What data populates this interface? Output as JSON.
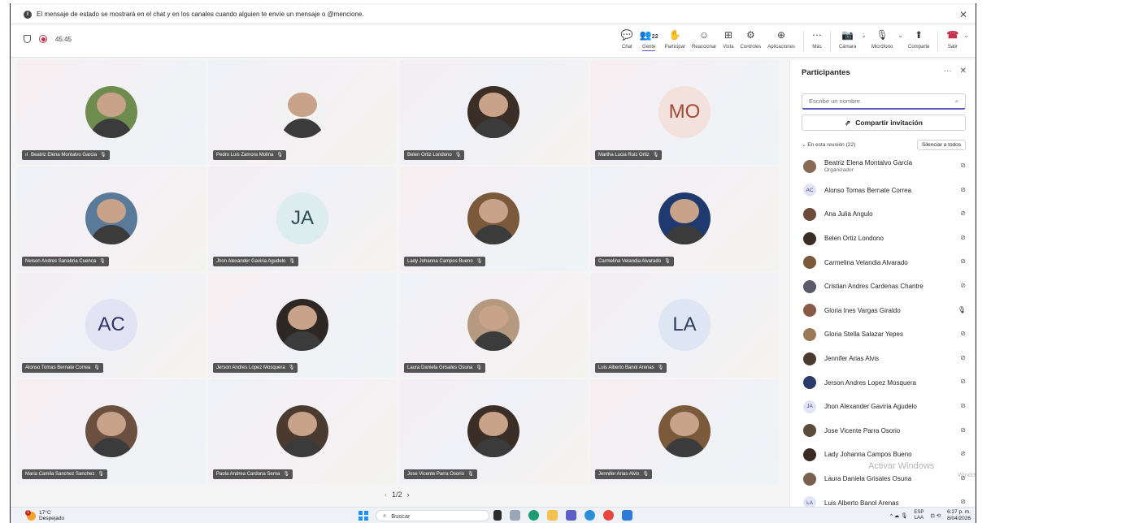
{
  "banner": {
    "text": "El mensaje de estado se mostrará en el chat y en los canales cuando alguien te envíe un mensaje o @mencione.",
    "info_glyph": "i",
    "close_glyph": "✕"
  },
  "toolbar": {
    "timer": "45:45",
    "people_count": "22",
    "buttons": [
      {
        "label": "Chat",
        "icon": "chat-icon",
        "glyph": "💬"
      },
      {
        "label": "Gente",
        "icon": "people-icon",
        "glyph": "👥"
      },
      {
        "label": "Participar",
        "icon": "raise-hand-icon",
        "glyph": "✋"
      },
      {
        "label": "Reaccionar",
        "icon": "react-icon",
        "glyph": "☺"
      },
      {
        "label": "Vista",
        "icon": "view-icon",
        "glyph": "⊞"
      },
      {
        "label": "Controles",
        "icon": "controls-icon",
        "glyph": "⚙"
      },
      {
        "label": "Aplicaciones",
        "icon": "apps-icon",
        "glyph": "⊕"
      },
      {
        "label": "Más",
        "icon": "more-icon",
        "glyph": "⋯"
      }
    ],
    "camera_label": "Cámara",
    "mic_label": "Micrófono",
    "share_label": "Comparte",
    "leave_label": "Salir",
    "camera_glyph": "📷",
    "mic_glyph": "🎙",
    "share_glyph": "⬆",
    "leave_glyph": "☎",
    "dropdown_glyph": "⌄"
  },
  "tiles": [
    {
      "name": "Beatriz Elena Montalvo Garcia",
      "avatar": "photo",
      "signal": "ıl"
    },
    {
      "name": "Pedro Luis Zamora Molina",
      "avatar": "photo"
    },
    {
      "name": "Belen Ortiz Londono",
      "avatar": "photo"
    },
    {
      "name": "Martha Lucia Ruiz Ortiz",
      "avatar": "initials",
      "initials": "MO"
    },
    {
      "name": "Nelson Andres Sanabria Cuenca",
      "avatar": "photo"
    },
    {
      "name": "Jhon Alexander Gaviria Agudelo",
      "avatar": "initials",
      "initials": "JA"
    },
    {
      "name": "Lady Johanna Campos Bueno",
      "avatar": "photo"
    },
    {
      "name": "Carmelina Velandia Alvarado",
      "avatar": "photo"
    },
    {
      "name": "Alonso Tomas Bernate Correa",
      "avatar": "initials",
      "initials": "AC"
    },
    {
      "name": "Jerson Andres Lopez Mosquera",
      "avatar": "photo"
    },
    {
      "name": "Laura Daniela Grisales Osuna",
      "avatar": "photo"
    },
    {
      "name": "Luis Alberto Banol Arenas",
      "avatar": "initials",
      "initials": "LA"
    },
    {
      "name": "Maria Camila Sanchez Sanchez",
      "avatar": "photo"
    },
    {
      "name": "Paola Andrea Cardona Serna",
      "avatar": "photo"
    },
    {
      "name": "Jose Vicente Parra Osorio",
      "avatar": "photo"
    },
    {
      "name": "Jennifer Arias Alvis",
      "avatar": "photo"
    }
  ],
  "pager": {
    "text": "1/2",
    "prev": "‹",
    "next": "›"
  },
  "panel": {
    "title": "Participantes",
    "more_glyph": "···",
    "close_glyph": "✕",
    "search_placeholder": "Escribe un nombre",
    "search_glyph": "⌕",
    "invite_label": "Compartir invitación",
    "invite_glyph": "⇗",
    "section_label": "En esta reunión (22)",
    "section_chevron": "⌄",
    "mute_all_label": "Silenciar a todos",
    "participants": [
      {
        "name": "Beatriz Elena Montalvo Garcia",
        "role": "Organizador",
        "mic": "muted"
      },
      {
        "name": "Alonso Tomas Bernate Correa",
        "initials": "AC",
        "mic": "muted"
      },
      {
        "name": "Ana Julia Angulo",
        "mic": "muted"
      },
      {
        "name": "Belen Ortiz Londono",
        "mic": "muted"
      },
      {
        "name": "Carmelina Velandia Alvarado",
        "mic": "muted"
      },
      {
        "name": "Cristian Andres Cardenas Chantre",
        "mic": "muted"
      },
      {
        "name": "Gloria Ines Vargas Giraldo",
        "mic": "on"
      },
      {
        "name": "Gloria Stella Salazar Yepes",
        "mic": "muted"
      },
      {
        "name": "Jennifer Arias Alvis",
        "mic": "muted"
      },
      {
        "name": "Jerson Andres Lopez Mosquera",
        "mic": "muted"
      },
      {
        "name": "Jhon Alexander Gaviria Agudelo",
        "initials": "JA",
        "mic": "muted"
      },
      {
        "name": "Jose Vicente Parra Osorio",
        "mic": "muted"
      },
      {
        "name": "Lady Johanna Campos Bueno",
        "mic": "muted"
      },
      {
        "name": "Laura Daniela Grisales Osuna",
        "mic": "muted"
      },
      {
        "name": "Luis Alberto Banol Arenas",
        "initials": "LA",
        "mic": "muted"
      }
    ]
  },
  "watermark": {
    "line1": "Activar Windows",
    "line2": "Windows."
  },
  "taskbar": {
    "temperature": "17°C",
    "weather": "Despejado",
    "search_placeholder": "Buscar",
    "search_glyph": "⌕",
    "lang_top": "ESP",
    "lang_bottom": "LAA",
    "time": "6:27 p. m.",
    "date": "8/04/2026",
    "tray_glyphs": "^ ☁ 🎙",
    "net_glyph": "⊡ ⟲"
  },
  "colors": {
    "accent": "#5b5fc7",
    "record": "#c4314b",
    "leave": "#c4314b"
  }
}
